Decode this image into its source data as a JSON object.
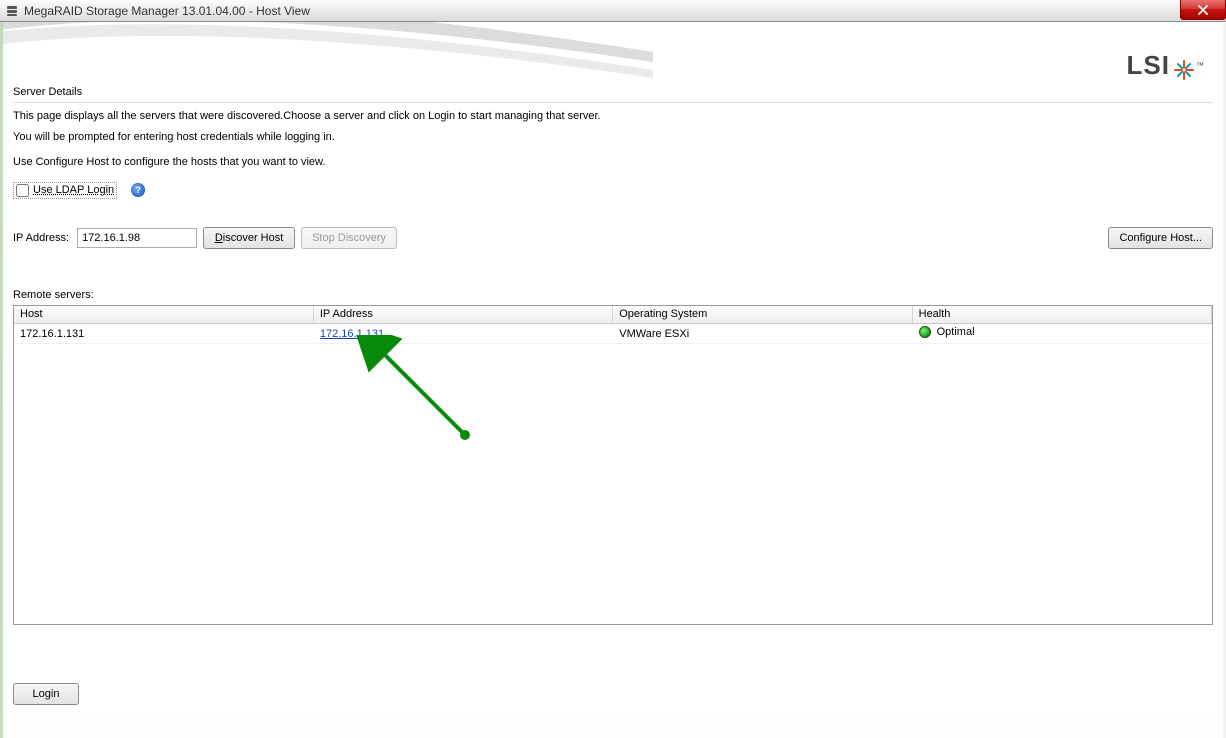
{
  "window": {
    "title": "MegaRAID Storage Manager 13.01.04.00 - Host View"
  },
  "branding": {
    "logo_text": "LSI"
  },
  "server_details": {
    "heading": "Server Details",
    "line1": "This page displays all the servers that were discovered.Choose a server and click on Login to start managing that server.",
    "line2": "You will be prompted for entering host credentials while logging in.",
    "line3": "Use Configure Host to configure the hosts that you want to view.",
    "ldap_label": "Use LDAP Login",
    "help_glyph": "?"
  },
  "ip_section": {
    "label": "IP Address:",
    "value": "172.16.1.98",
    "discover_label": "Discover Host",
    "stop_label": "Stop Discovery",
    "configure_label": "Configure Host..."
  },
  "remote": {
    "label": "Remote servers:",
    "columns": {
      "host": "Host",
      "ip": "IP Address",
      "os": "Operating System",
      "health": "Health"
    },
    "rows": [
      {
        "host": "172.16.1.131",
        "ip": "172.16.1.131",
        "os": "VMWare ESXi",
        "health": "Optimal"
      }
    ]
  },
  "footer": {
    "login_label": "Login"
  }
}
